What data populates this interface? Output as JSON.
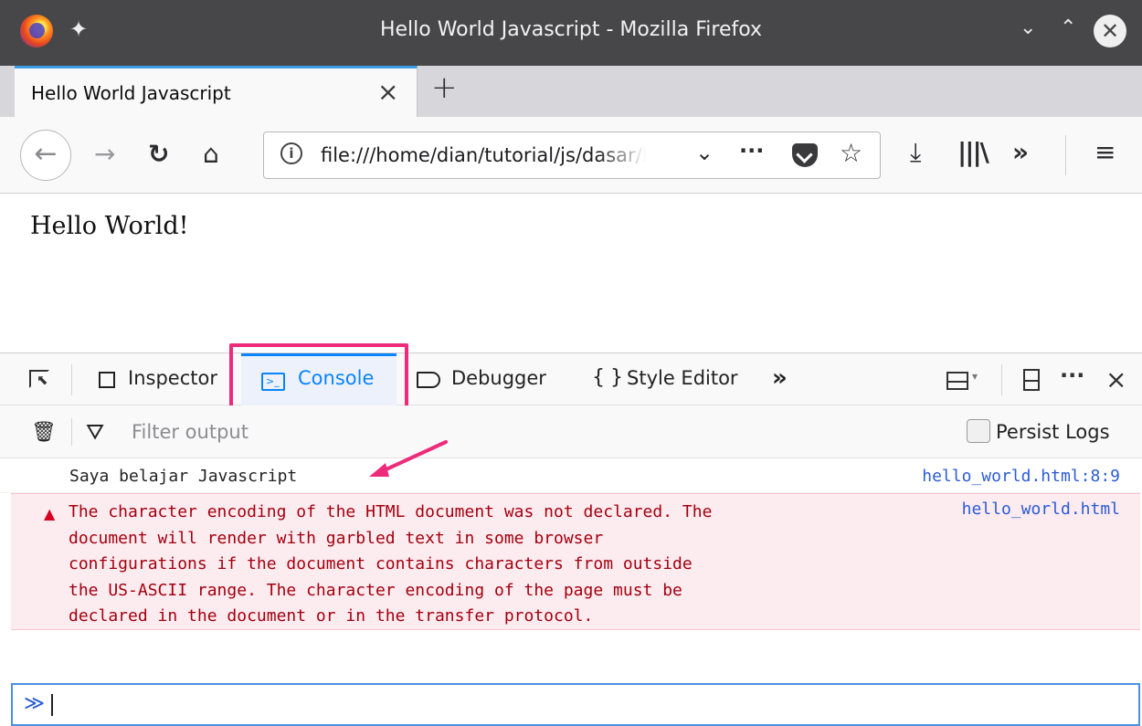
{
  "window": {
    "title": "Hello World Javascript - Mozilla Firefox"
  },
  "tab": {
    "title": "Hello World Javascript"
  },
  "urlbar": {
    "url": "file:///home/dian/tutorial/js/dasar/hello_world.html"
  },
  "page": {
    "text": "Hello World!"
  },
  "devtools": {
    "tabs": [
      {
        "label": "Inspector"
      },
      {
        "label": "Console"
      },
      {
        "label": "Debugger"
      },
      {
        "label": "Style Editor"
      }
    ],
    "active_tab": "Console",
    "filter_placeholder": "Filter output",
    "persist_logs_label": "Persist Logs",
    "persist_logs_checked": false
  },
  "console": {
    "messages": [
      {
        "type": "log",
        "text": "Saya belajar Javascript",
        "source": "hello_world.html:8:9"
      },
      {
        "type": "error",
        "text": "The character encoding of the HTML document was not declared. The\ndocument will render with garbled text in some browser\nconfigurations if the document contains characters from outside\nthe US-ASCII range. The character encoding of the page must be\ndeclared in the document or in the transfer protocol.",
        "source": "hello_world.html"
      }
    ]
  },
  "colors": {
    "accent": "#0a84ff",
    "highlight": "#ee2a7b",
    "error_text": "#a4000f",
    "error_bg": "#fcebef",
    "link": "#2b5bd7"
  },
  "icons": {
    "titlebar": [
      "firefox-logo",
      "pin-icon",
      "minimize-icon",
      "maximize-icon",
      "close-icon"
    ],
    "nav": [
      "back-icon",
      "forward-icon",
      "reload-icon",
      "home-icon"
    ],
    "urlbar": [
      "info-icon",
      "chevron-down-icon",
      "more-icon",
      "pocket-icon",
      "star-icon"
    ],
    "toolbar": [
      "download-icon",
      "library-icon",
      "overflow-icon",
      "hamburger-menu-icon"
    ],
    "devtools": [
      "element-picker-icon",
      "dock-icon",
      "split-console-icon",
      "more-icon",
      "close-icon",
      "trash-icon",
      "filter-icon",
      "warning-icon",
      "prompt-icon"
    ]
  }
}
